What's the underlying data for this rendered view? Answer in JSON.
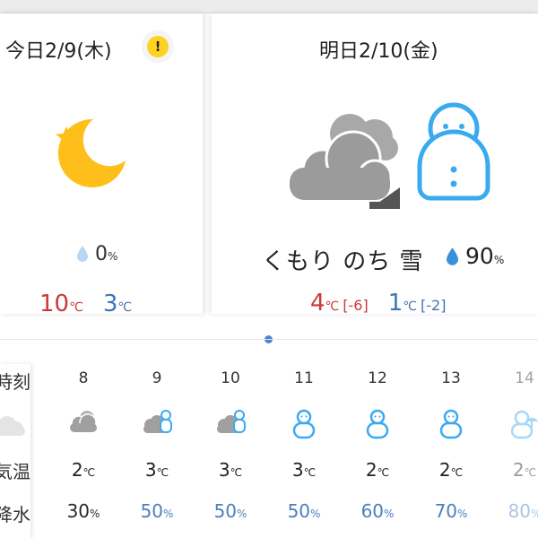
{
  "today": {
    "date": "今日2/9(木)",
    "weather_icon": "moon-star-icon",
    "alert_icon": "warning-icon",
    "alert_symbol": "!",
    "precip": "0",
    "precip_unit": "%",
    "high": "10",
    "low": "3",
    "temp_unit": "℃"
  },
  "tomorrow": {
    "date": "明日2/10(金)",
    "weather_icon": "cloudy-then-snow-icon",
    "condition": "くもり のち 雪",
    "precip": "90",
    "precip_unit": "%",
    "high": "4",
    "high_diff": "[-6]",
    "low": "1",
    "low_diff": "[-2]",
    "temp_unit": "℃"
  },
  "hourly": {
    "row_labels": {
      "time": "時刻",
      "temp": "気温",
      "precip": "降水"
    },
    "hours": [
      {
        "time": "8",
        "icon": "cloud-icon",
        "temp": "2",
        "precip": "30"
      },
      {
        "time": "9",
        "icon": "cloud-snow-icon",
        "temp": "3",
        "precip": "50"
      },
      {
        "time": "10",
        "icon": "cloud-snow-icon",
        "temp": "3",
        "precip": "50"
      },
      {
        "time": "11",
        "icon": "snowman-icon",
        "temp": "3",
        "precip": "50"
      },
      {
        "time": "12",
        "icon": "snowman-icon",
        "temp": "2",
        "precip": "60"
      },
      {
        "time": "13",
        "icon": "snowman-icon",
        "temp": "2",
        "precip": "70"
      },
      {
        "time": "14",
        "icon": "snowman-umbrella-icon",
        "temp": "2",
        "precip": "80"
      }
    ],
    "temp_unit": "℃",
    "precip_unit": "%"
  },
  "colors": {
    "high": "#c9393b",
    "low": "#3e74b6",
    "snow": "#3aaaf0",
    "cloud": "#9e9e9e",
    "moon": "#ffbf1a",
    "page_indicator": "#4a86d0"
  }
}
